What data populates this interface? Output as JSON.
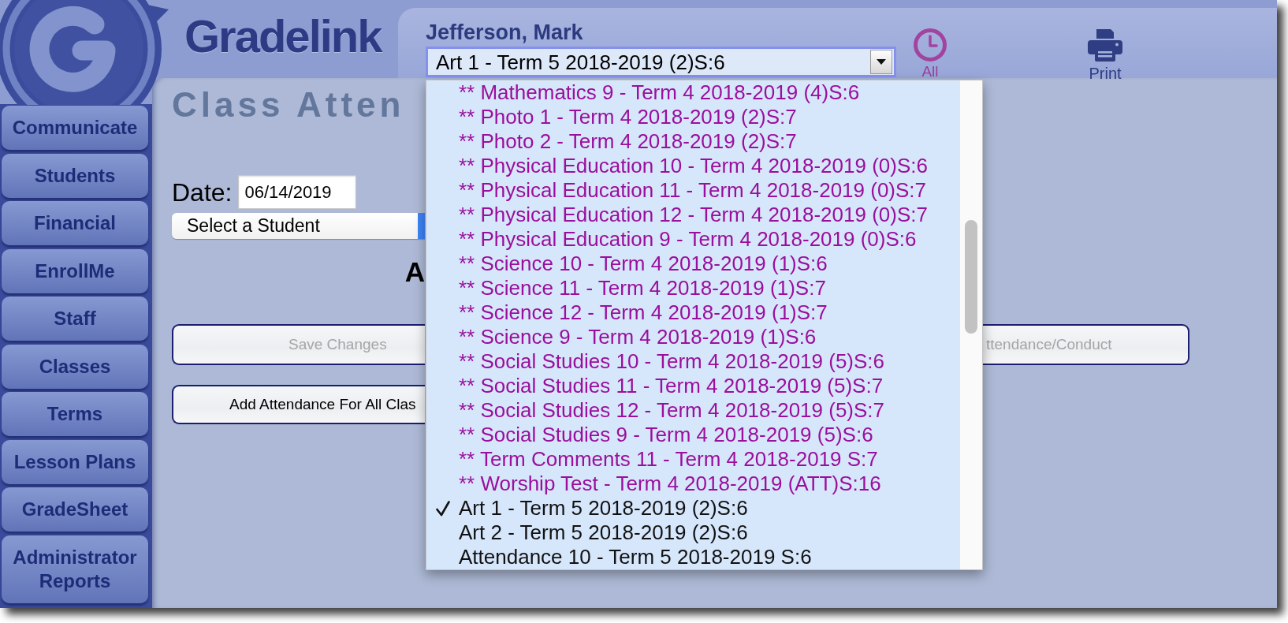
{
  "logo": {
    "name": "Gradelink"
  },
  "header": {
    "user_name": "Jefferson, Mark",
    "class_select": {
      "value": "Art 1 - Term 5 2018-2019 (2)S:6"
    },
    "tools": [
      {
        "kind": "clock",
        "label": "All"
      },
      {
        "kind": "printer",
        "label": "Print"
      }
    ]
  },
  "sidebar": {
    "items": [
      {
        "label": "Communicate"
      },
      {
        "label": "Students"
      },
      {
        "label": "Financial"
      },
      {
        "label": "EnrollMe"
      },
      {
        "label": "Staff"
      },
      {
        "label": "Classes"
      },
      {
        "label": "Terms"
      },
      {
        "label": "Lesson Plans"
      },
      {
        "label": "GradeSheet"
      },
      {
        "label": "Administrator Reports"
      }
    ]
  },
  "page": {
    "title": "Class Atten",
    "date_label": "Date:",
    "date_field": {
      "value": "06/14/2019"
    },
    "student_select": {
      "value": "Select a Student"
    },
    "section_heading": "A",
    "button_rows": [
      [
        {
          "label": "Save Changes",
          "disabled": true
        },
        {
          "label": "ttendance/Conduct",
          "disabled": true
        }
      ],
      [
        {
          "label": "Add Attendance For All Clas",
          "disabled": false
        }
      ]
    ]
  },
  "class_dropdown": {
    "options": [
      {
        "label": "** Mathematics 9 - Term 4 2018-2019 (4)S:6",
        "color": "#9a0f9c",
        "selected": false
      },
      {
        "label": "** Photo 1 - Term 4 2018-2019 (2)S:7",
        "color": "#9a0f9c",
        "selected": false
      },
      {
        "label": "** Photo 2 - Term 4 2018-2019 (2)S:7",
        "color": "#9a0f9c",
        "selected": false
      },
      {
        "label": "** Physical Education 10 - Term 4 2018-2019 (0)S:6",
        "color": "#9a0f9c",
        "selected": false
      },
      {
        "label": "** Physical Education 11 - Term 4 2018-2019 (0)S:7",
        "color": "#9a0f9c",
        "selected": false
      },
      {
        "label": "** Physical Education 12 - Term 4 2018-2019 (0)S:7",
        "color": "#9a0f9c",
        "selected": false
      },
      {
        "label": "** Physical Education 9 - Term 4 2018-2019 (0)S:6",
        "color": "#9a0f9c",
        "selected": false
      },
      {
        "label": "** Science 10 - Term 4 2018-2019 (1)S:6",
        "color": "#9a0f9c",
        "selected": false
      },
      {
        "label": "** Science 11 - Term 4 2018-2019 (1)S:7",
        "color": "#9a0f9c",
        "selected": false
      },
      {
        "label": "** Science 12 - Term 4 2018-2019 (1)S:7",
        "color": "#9a0f9c",
        "selected": false
      },
      {
        "label": "** Science 9 - Term 4 2018-2019 (1)S:6",
        "color": "#9a0f9c",
        "selected": false
      },
      {
        "label": "** Social Studies 10 - Term 4 2018-2019 (5)S:6",
        "color": "#9a0f9c",
        "selected": false
      },
      {
        "label": "** Social Studies 11 - Term 4 2018-2019 (5)S:7",
        "color": "#9a0f9c",
        "selected": false
      },
      {
        "label": "** Social Studies 12 - Term 4 2018-2019 (5)S:7",
        "color": "#9a0f9c",
        "selected": false
      },
      {
        "label": "** Social Studies 9 - Term 4 2018-2019 (5)S:6",
        "color": "#9a0f9c",
        "selected": false
      },
      {
        "label": "** Term Comments 11 - Term 4 2018-2019 S:7",
        "color": "#9a0f9c",
        "selected": false
      },
      {
        "label": "** Worship Test - Term 4 2018-2019 (ATT)S:16",
        "color": "#9a0f9c",
        "selected": false
      },
      {
        "label": "Art 1 - Term 5 2018-2019 (2)S:6",
        "color": "#111111",
        "selected": true
      },
      {
        "label": "Art 2 - Term 5 2018-2019 (2)S:6",
        "color": "#111111",
        "selected": false
      },
      {
        "label": "Attendance 10 - Term 5 2018-2019 S:6",
        "color": "#111111",
        "selected": false
      }
    ]
  }
}
